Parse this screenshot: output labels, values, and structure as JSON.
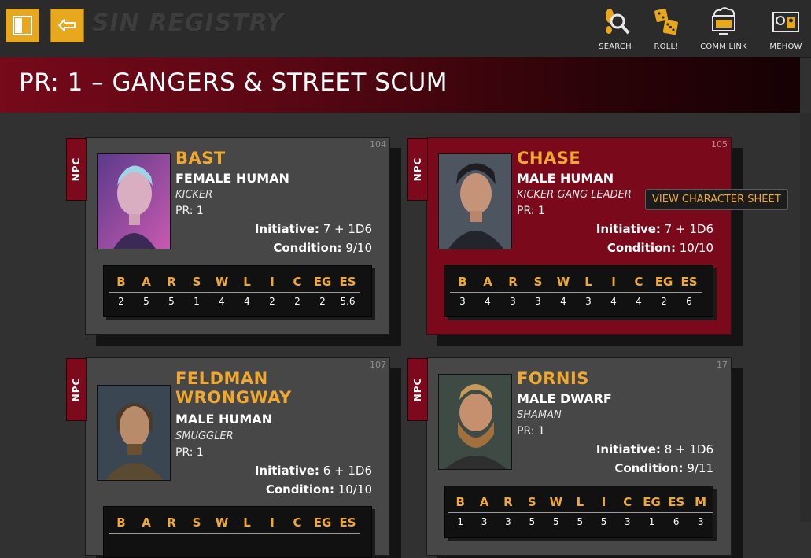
{
  "app": {
    "logo": "SIN REGISTRY"
  },
  "nav": [
    {
      "label": "SEARCH",
      "icon": "search-icon"
    },
    {
      "label": "ROLL!",
      "icon": "dice-icon"
    },
    {
      "label": "COMM LINK",
      "icon": "comm-link-icon"
    },
    {
      "label": "MEHOW",
      "icon": "profile-icon"
    }
  ],
  "page": {
    "title": "PR: 1 – GANGERS & STREET SCUM"
  },
  "tooltip": "VIEW CHARACTER SHEET",
  "colors": {
    "accent": "#f0a830",
    "title_red": "#76091a",
    "highlight_card": "#7a0a1b"
  },
  "cards": [
    {
      "badge": "NPC",
      "id": "104",
      "name": "BAST",
      "race": "FEMALE HUMAN",
      "role": "KICKER",
      "pr": "PR: 1",
      "initiative_label": "Initiative:",
      "initiative": "7 + 1D6",
      "condition_label": "Condition:",
      "condition": "9/10",
      "attr_keys": [
        "B",
        "A",
        "R",
        "S",
        "W",
        "L",
        "I",
        "C",
        "EG",
        "ES"
      ],
      "attr_vals": [
        "2",
        "5",
        "5",
        "1",
        "4",
        "4",
        "2",
        "2",
        "2",
        "5.6"
      ]
    },
    {
      "badge": "NPC",
      "id": "105",
      "name": "CHASE",
      "race": "MALE HUMAN",
      "role": "KICKER GANG LEADER",
      "pr": "PR: 1",
      "initiative_label": "Initiative:",
      "initiative": "7 + 1D6",
      "condition_label": "Condition:",
      "condition": "10/10",
      "attr_keys": [
        "B",
        "A",
        "R",
        "S",
        "W",
        "L",
        "I",
        "C",
        "EG",
        "ES"
      ],
      "attr_vals": [
        "3",
        "4",
        "3",
        "3",
        "4",
        "3",
        "4",
        "4",
        "2",
        "6"
      ]
    },
    {
      "badge": "NPC",
      "id": "107",
      "name_line1": "FELDMAN",
      "name_line2": "WRONGWAY",
      "race": "MALE HUMAN",
      "role": "SMUGGLER",
      "pr": "PR: 1",
      "initiative_label": "Initiative:",
      "initiative": "6 + 1D6",
      "condition_label": "Condition:",
      "condition": "10/10",
      "attr_keys": [
        "B",
        "A",
        "R",
        "S",
        "W",
        "L",
        "I",
        "C",
        "EG",
        "ES"
      ]
    },
    {
      "badge": "NPC",
      "id": "17",
      "name": "FORNIS",
      "race": "MALE DWARF",
      "role": "SHAMAN",
      "pr": "PR: 1",
      "initiative_label": "Initiative:",
      "initiative": "8 + 1D6",
      "condition_label": "Condition:",
      "condition": "9/11",
      "attr_keys": [
        "B",
        "A",
        "R",
        "S",
        "W",
        "L",
        "I",
        "C",
        "EG",
        "ES",
        "M"
      ],
      "attr_vals": [
        "1",
        "3",
        "3",
        "5",
        "5",
        "5",
        "5",
        "3",
        "1",
        "6",
        "3"
      ]
    }
  ]
}
